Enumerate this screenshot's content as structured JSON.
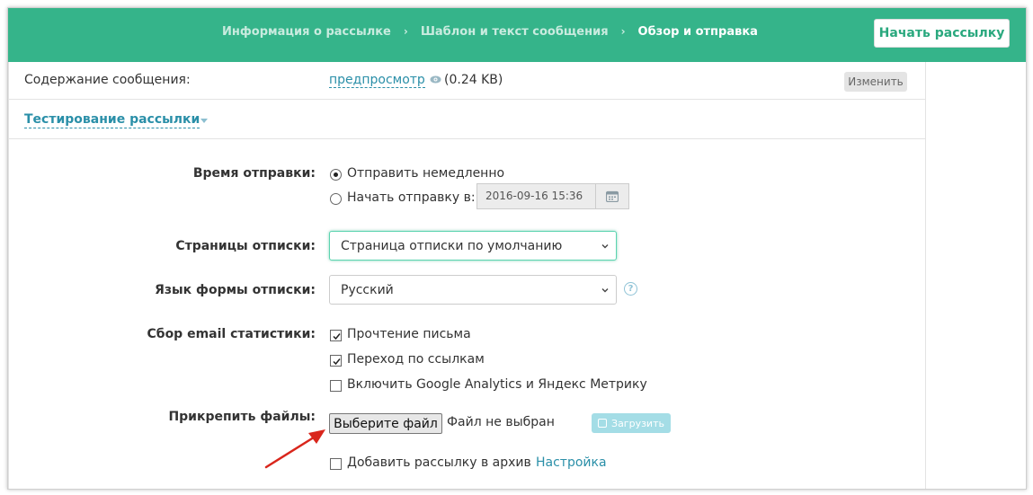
{
  "header": {
    "steps": [
      {
        "label": "Информация о рассылке",
        "active": false
      },
      {
        "label": "Шаблон и текст сообщения",
        "active": false
      },
      {
        "label": "Обзор и отправка",
        "active": true
      }
    ],
    "separator": "›",
    "start_button": "Начать рассылку",
    "color": "#35b48a"
  },
  "message_content": {
    "label": "Содержание сообщения:",
    "preview_link": "предпросмотр",
    "size": "(0.24 KB)",
    "edit_button": "Изменить"
  },
  "testing": {
    "label": "Тестирование рассылки"
  },
  "send_time": {
    "label": "Время отправки:",
    "options": [
      {
        "label": "Отправить немедленно",
        "checked": true
      },
      {
        "label": "Начать отправку в:",
        "checked": false
      }
    ],
    "datetime_value": "2016-09-16 15:36"
  },
  "unsubscribe_page": {
    "label": "Страницы отписки:",
    "selected": "Страница отписки по умолчанию"
  },
  "unsubscribe_language": {
    "label": "Язык формы отписки:",
    "selected": "Русский",
    "help": "?"
  },
  "email_stats": {
    "label": "Сбор email статистики:",
    "options": [
      {
        "label": "Прочтение письма",
        "checked": true
      },
      {
        "label": "Переход по ссылкам",
        "checked": true
      },
      {
        "label": "Включить Google Analytics и Яндекс Метрику",
        "checked": false
      }
    ]
  },
  "attach_files": {
    "label": "Прикрепить файлы:",
    "choose_button": "Выберите файл",
    "status": "Файл не выбран",
    "upload_button": "Загрузить"
  },
  "archive": {
    "label": "Добавить рассылку в архив",
    "checked": false,
    "settings_link": "Настройка"
  },
  "annotation": {
    "arrow_color": "#d9261c"
  }
}
